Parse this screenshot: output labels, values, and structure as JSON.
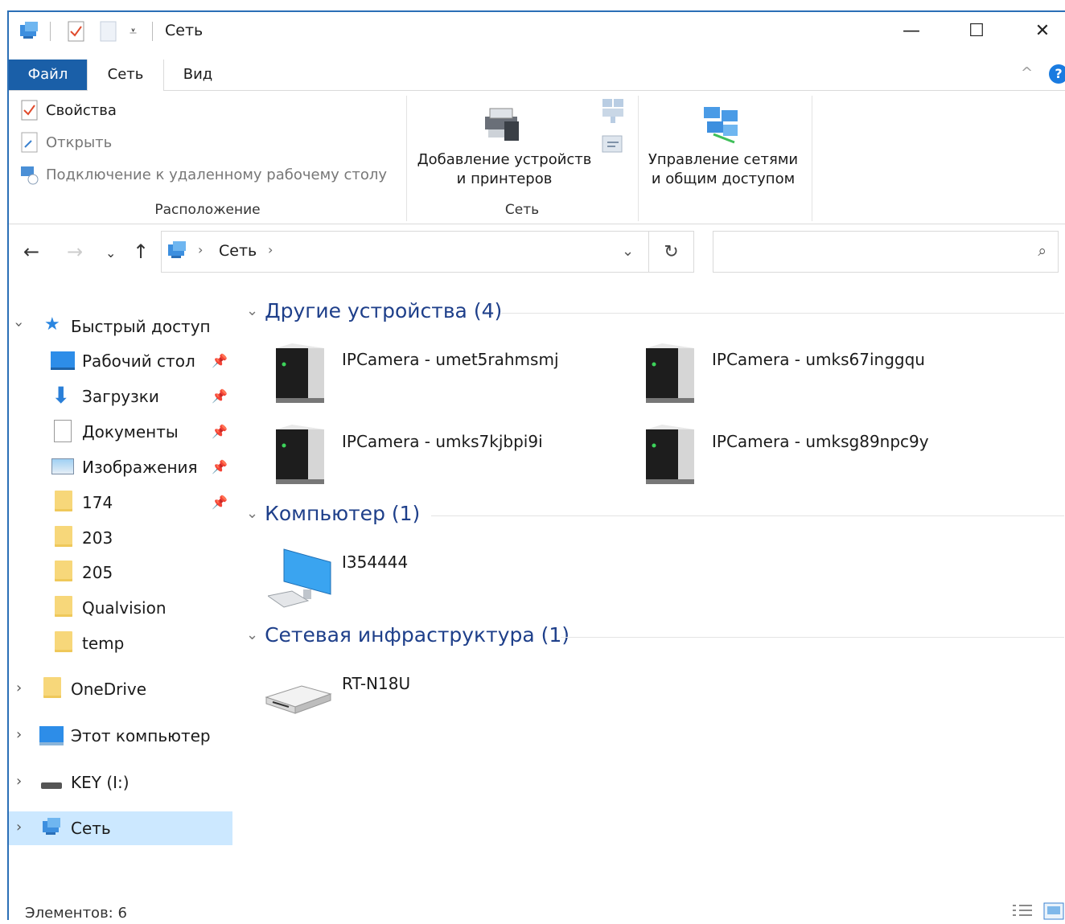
{
  "window": {
    "title": "Сеть",
    "controls": {
      "minimize": "—",
      "maximize": "☐",
      "close": "✕"
    }
  },
  "ribbon_tabs": [
    "Файл",
    "Сеть",
    "Вид"
  ],
  "ribbon": {
    "location_group": {
      "items": [
        "Свойства",
        "Открыть",
        "Подключение к удаленному рабочему столу"
      ],
      "label": "Расположение"
    },
    "network_group": {
      "add_devices_line1": "Добавление устройств",
      "add_devices_line2": "и принтеров",
      "manage_line1": "Управление сетями",
      "manage_line2": "и общим доступом",
      "label": "Сеть"
    }
  },
  "address_bar": {
    "breadcrumb": [
      "Сеть"
    ],
    "search_placeholder": ""
  },
  "sidebar": {
    "quick_access": "Быстрый доступ",
    "quick_items": [
      "Рабочий стол",
      "Загрузки",
      "Документы",
      "Изображения",
      "174",
      "203",
      "205",
      "Qualvision",
      "temp"
    ],
    "roots": [
      "OneDrive",
      "Этот компьютер",
      "KEY (I:)",
      "Сеть"
    ]
  },
  "groups": {
    "other": {
      "title": "Другие устройства (4)",
      "devices": [
        "IPCamera - umet5rahmsmj",
        "IPCamera - umks67inggqu",
        "IPCamera - umks7kjbpi9i",
        "IPCamera - umksg89npc9y"
      ]
    },
    "computer": {
      "title": "Компьютер (1)",
      "devices": [
        "I354444"
      ]
    },
    "infra": {
      "title": "Сетевая инфраструктура (1)",
      "devices": [
        "RT-N18U"
      ]
    }
  },
  "status_bar": {
    "items_count": "Элементов: 6"
  },
  "colors": {
    "accent": "#1a5fa8",
    "group_header": "#1e3f8a",
    "selection": "#cce8ff",
    "folder": "#f7d77a"
  }
}
